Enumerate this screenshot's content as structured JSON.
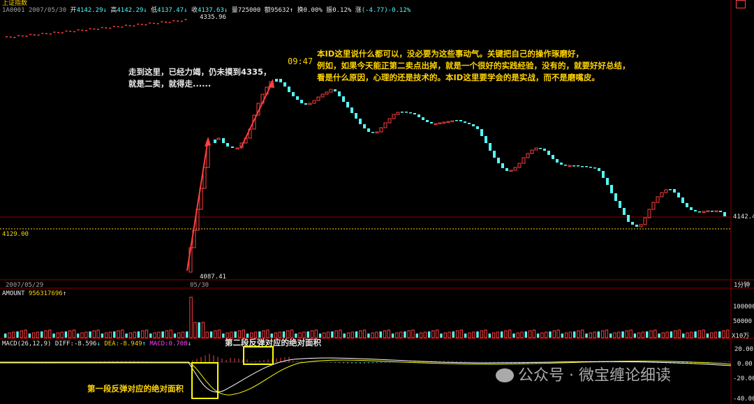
{
  "header": {
    "index_name": "上证指数",
    "code": "1A0001",
    "date": "2007/05/30",
    "open_label": "开",
    "open": "4142.29",
    "high_label": "高",
    "high": "4142.29",
    "low_label": "低",
    "low": "4137.47",
    "close_label": "收",
    "close": "4137.63",
    "volume_label": "量",
    "volume": "725000",
    "amount_label": "额",
    "amount": "95632",
    "turnover_label": "换",
    "turnover": "0.00%",
    "amplitude_label": "振",
    "amplitude": "0.12%",
    "change_label": "涨",
    "change": "(-4.77)-0.12%"
  },
  "price_panel": {
    "high_mark": "4335.96",
    "low_mark": "4087.41",
    "last_price": "4142.4",
    "ref_line": "4129.00",
    "time_label": "09:47",
    "date_left": "2007/05/29",
    "date_mid": "05/30",
    "period": "1分钟"
  },
  "annotations": {
    "left_lines": [
      "走到这里，已经力竭，仍未摸到4335，",
      "就是二卖，就得走......"
    ],
    "right_lines": [
      "本ID这里说什么都可以，没必要为这些事动气。关键把自己的操作琢磨好，",
      "例如，如果今天能正第二卖点出掉，就是一个很好的实践经验，没有的，就要好好总结，",
      "看是什么原因，心理的还是技术的。本ID这里要学会的是实战，而不是磨嘴皮。"
    ],
    "second_area": "第二段反弹对应的绝对面积",
    "first_area": "第一段反弹对应的绝对面积"
  },
  "volume_panel": {
    "label": "AMOUNT",
    "value": "956317696",
    "ticks": [
      "100000",
      "50000"
    ],
    "unit": "X10万"
  },
  "macd_panel": {
    "label": "MACD(26,12,9)",
    "diff_label": "DIFF:",
    "diff": "-8.596",
    "dea_label": "DEA:",
    "dea": "-8.949",
    "macd_label": "MACD:",
    "macd": "0.708",
    "ticks": [
      "20.00",
      "0.00",
      "-20.00",
      "-40.00"
    ]
  },
  "watermark": "公众号 · 微宝缠论细读",
  "colors": {
    "up": "#ff4040",
    "down": "#54fcfc",
    "dea": "#ffff00",
    "diff": "#ffffff",
    "grid": "#8b0000"
  }
}
